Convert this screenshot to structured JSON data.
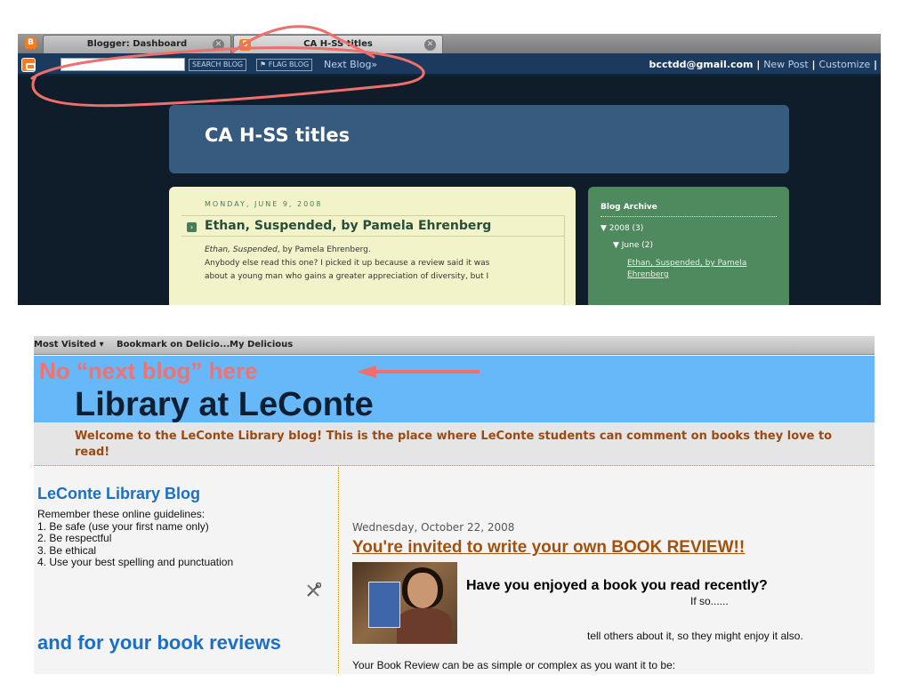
{
  "top_screenshot": {
    "tabs": [
      {
        "label": "Blogger: Dashboard",
        "favicon": "blogger-icon"
      },
      {
        "label": "CA H-SS titles",
        "favicon": "blogger-icon"
      }
    ],
    "tab_close_glyph": "✕",
    "navbar": {
      "search_button": "SEARCH BLOG",
      "flag_button": "⚑ FLAG BLOG",
      "next_blog": "Next Blog»",
      "user_email": "bcctdd@gmail.com",
      "separator": " | ",
      "new_post": "New Post",
      "customize": "Customize",
      "trailing_separator": " |"
    },
    "blog": {
      "title": "CA H-SS titles",
      "post_date": "MONDAY, JUNE 9, 2008",
      "post_title": "Ethan, Suspended, by Pamela Ehrenberg",
      "post_body_italic": "Ethan, Suspended",
      "post_body_line1_rest": ", by Pamela Ehrenberg.",
      "post_body_line2": "Anybody else read this one? I picked it up because a review said it was",
      "post_body_line3": "about a young man who gains a greater appreciation of diversity, but I",
      "archive_title": "Blog Archive",
      "archive_year": "▼ 2008 (3)",
      "archive_month": "▼ June (2)",
      "archive_post": "Ethan, Suspended, by Pamela Ehrenberg"
    },
    "colors": {
      "annotation": "#ee6f6b",
      "header_bg": "#375a7f",
      "post_bg": "#f2f3c8",
      "archive_bg": "#4e8a5e"
    }
  },
  "bottom_screenshot": {
    "bookmarks": [
      "Most Visited ▾",
      "Bookmark on Delicio...",
      "My Delicious"
    ],
    "annotation_text": "No “next blog” here",
    "blog_title": "Library at LeConte",
    "welcome": "Welcome to the LeConte Library blog! This is the place where LeConte students can comment on books they love to read!",
    "sidebar": {
      "title": "LeConte Library Blog",
      "intro": "Remember these online guidelines:",
      "guidelines": [
        "1. Be safe (use your first name only)",
        "2. Be respectful",
        "3. Be ethical",
        "4. Use your best spelling and punctuation"
      ],
      "title2": "and for your book reviews"
    },
    "post": {
      "date": "Wednesday, October 22, 2008",
      "title": "You're invited to write your own BOOK REVIEW!!",
      "question": "Have you enjoyed a book you read recently?",
      "if_so": "If so......",
      "tell": "tell others about it, so they might enjoy it also.",
      "cutoff": "Your Book Review can be as simple or complex as you want it to be:"
    },
    "colors": {
      "header_bg": "#66b8f8",
      "title": "#0c1f33",
      "welcome_text": "#9c4a12",
      "link_blue": "#1b6fc4",
      "post_title": "#a1520f"
    }
  }
}
